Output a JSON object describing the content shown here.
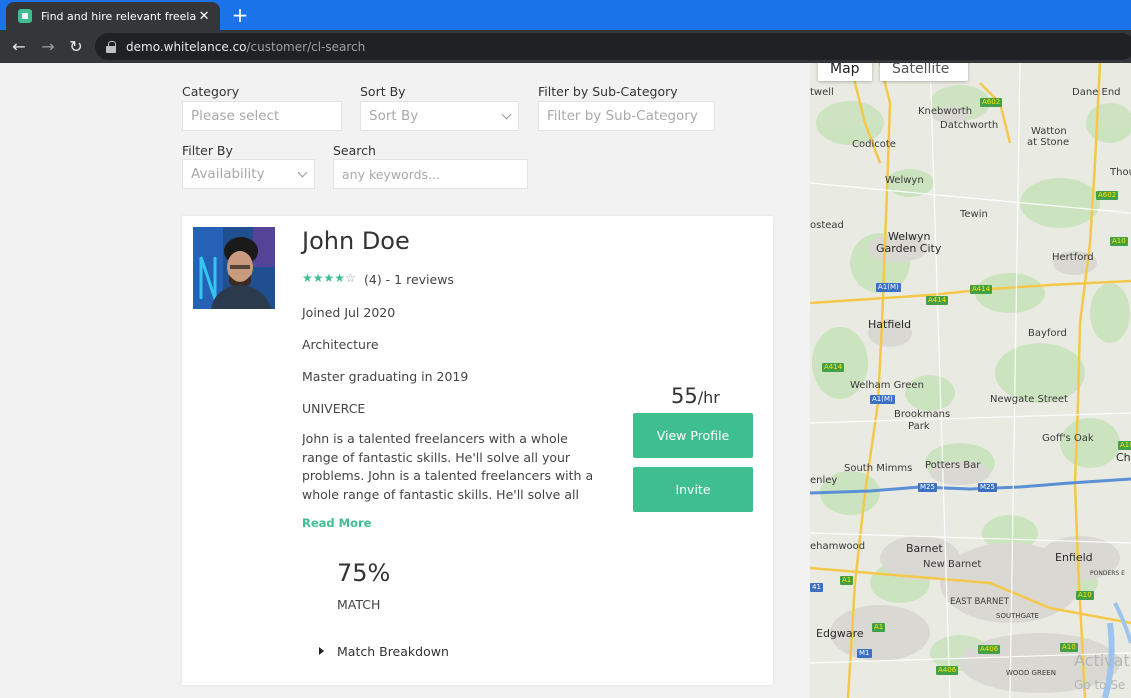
{
  "browser": {
    "tab_title": "Find and hire relevant freelancers",
    "tab_close": "✕",
    "new_tab": "+",
    "back": "←",
    "forward": "→",
    "reload": "↻",
    "url_host": "demo.whitelance.co",
    "url_path": "/customer/cl-search"
  },
  "filters": {
    "category": {
      "label": "Category",
      "placeholder": "Please select"
    },
    "sort_by": {
      "label": "Sort By",
      "value": "Sort By"
    },
    "sub_category": {
      "label": "Filter by Sub-Category",
      "placeholder": "Filter by Sub-Category"
    },
    "filter_by": {
      "label": "Filter By",
      "value": "Availability"
    },
    "search": {
      "label": "Search",
      "placeholder": "any keywords..."
    }
  },
  "freelancer": {
    "name": "John Doe",
    "rating": 4,
    "rating_max": 5,
    "rating_text": "(4) - 1 reviews",
    "joined": "Joined Jul 2020",
    "field": "Architecture",
    "education": "Master graduating in 2019",
    "school": "UNIVERCE",
    "bio": "John is a talented freelancers with a whole range of fantastic skills. He'll solve all your problems. John is a talented freelancers with a whole range of fantastic skills. He'll solve all your",
    "read_more": "Read More",
    "rate_value": "55",
    "rate_unit": "/hr",
    "view_profile": "View Profile",
    "invite": "Invite",
    "match_percent": "75%",
    "match_label": "MATCH",
    "match_breakdown": "Match Breakdown"
  },
  "map": {
    "map_btn": "Map",
    "satellite_btn": "Satellite",
    "places": {
      "twell": "twell",
      "knebworth": "Knebworth",
      "datchworth": "Datchworth",
      "dane_end": "Dane End",
      "watton": "Watton",
      "at_stone": "at Stone",
      "codicote": "Codicote",
      "welwyn": "Welwyn",
      "thou": "Thou",
      "ostead": "ostead",
      "tewin": "Tewin",
      "welwyn_gc1": "Welwyn",
      "welwyn_gc2": "Garden City",
      "hertford": "Hertford",
      "hatfield": "Hatfield",
      "bayford": "Bayford",
      "welham": "Welham Green",
      "newgate": "Newgate Street",
      "brookmans1": "Brookmans",
      "brookmans2": "Park",
      "goffs": "Goff's Oak",
      "ch": "Ch",
      "south_mimms": "South Mimms",
      "potters": "Potters Bar",
      "enley": "enley",
      "ehamwood": "ehamwood",
      "barnet": "Barnet",
      "new_barnet": "New Barnet",
      "enfield": "Enfield",
      "ponders": "PONDERS E",
      "east_barnet": "EAST BARNET",
      "southgate": "SOUTHGATE",
      "edgware": "Edgware",
      "wood_green": "WOOD GREEN"
    },
    "roads": {
      "a602": "A602",
      "a602b": "A602",
      "a10": "A10",
      "a1m": "A1(M)",
      "a414": "A414",
      "a414b": "A414",
      "a414c": "A414",
      "a1m2": "A1(M)",
      "a10b": "A10",
      "m25": "M25",
      "m25b": "M25",
      "a1": "A1",
      "a10c": "A10",
      "a41": "41",
      "a406": "A406",
      "a406b": "A406",
      "m1": "M1",
      "a10d": "A10",
      "a1b": "A1"
    }
  },
  "watermark": {
    "line1": "Activat",
    "line2": "Go to Se"
  }
}
